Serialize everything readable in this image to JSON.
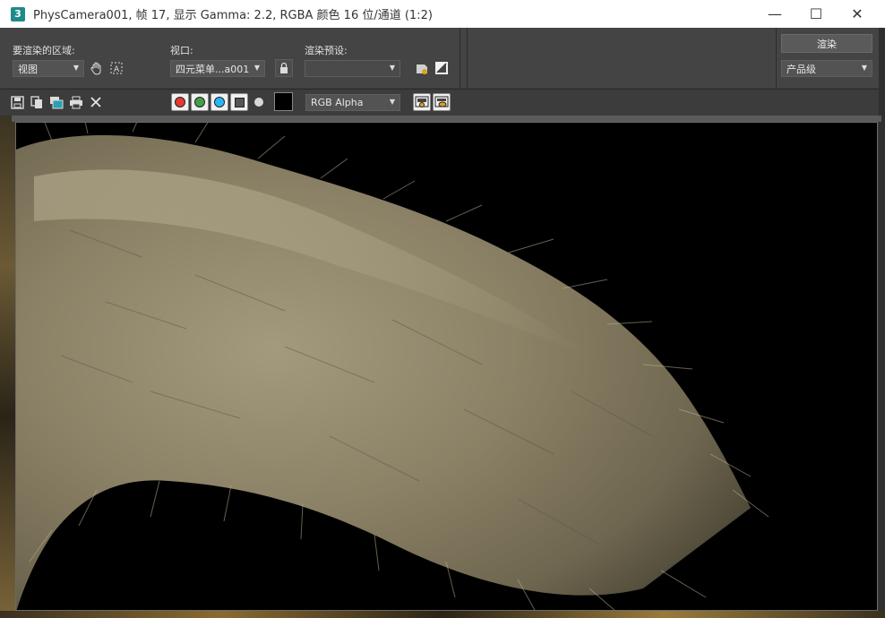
{
  "window": {
    "app_icon_text": "3",
    "title": "PhysCamera001, 帧 17, 显示 Gamma: 2.2, RGBA 颜色 16 位/通道 (1:2)",
    "minimize": "—",
    "maximize": "☐",
    "close": "✕"
  },
  "render_area": {
    "label": "要渲染的区域:",
    "value": "视图"
  },
  "viewport": {
    "label": "视口:",
    "value": "四元菜单...a001"
  },
  "render_preset": {
    "label": "渲染预设:",
    "value": ""
  },
  "render": {
    "button_label": "渲染",
    "quality_value": "产品级"
  },
  "display": {
    "channel_dropdown": "RGB Alpha"
  },
  "channels": {
    "red": "#e53935",
    "green": "#43a047",
    "blue": "#29b6f6"
  },
  "icons": [
    "save-icon",
    "copy-icon",
    "clone-icon",
    "print-icon",
    "clear-icon",
    "hand-icon",
    "region-icon",
    "lock-icon",
    "preset-icon",
    "gamma-icon",
    "view-framebuffer-icon"
  ]
}
